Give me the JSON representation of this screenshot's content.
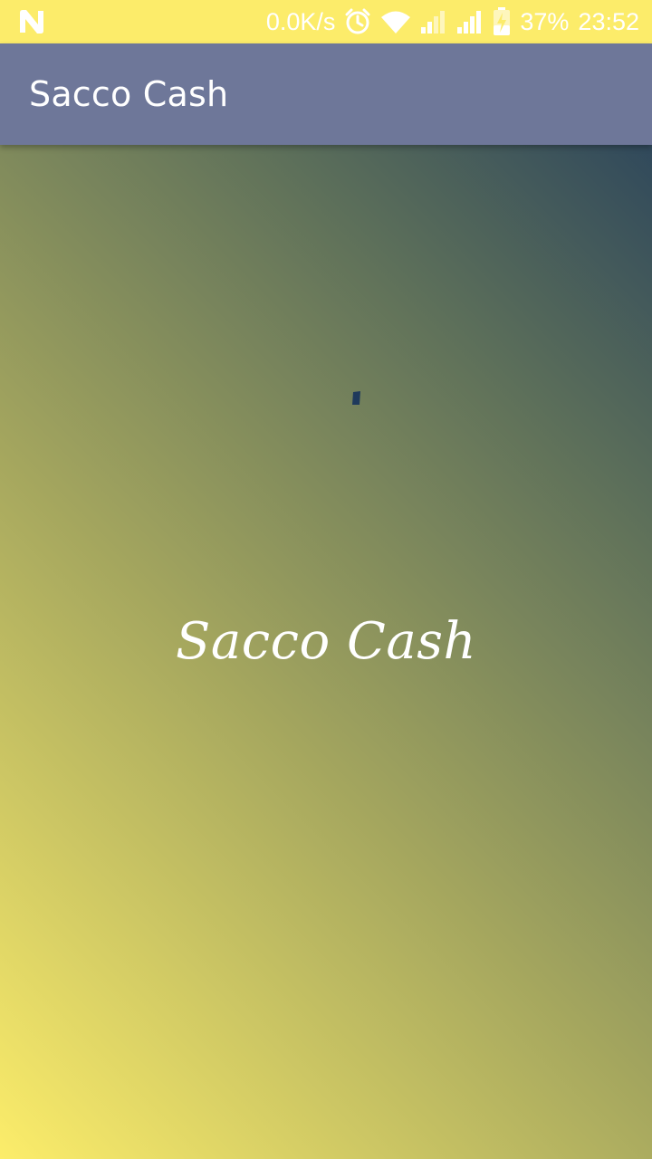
{
  "status_bar": {
    "network_speed": "0.0K/s",
    "battery_percent": "37%",
    "time": "23:52",
    "icons": [
      "n-logo-icon",
      "alarm-icon",
      "wifi-icon",
      "signal-icon",
      "signal-icon",
      "battery-charging-icon"
    ]
  },
  "app_bar": {
    "title": "Sacco Cash",
    "background_color": "#6e7799"
  },
  "splash": {
    "logo_text": "Sacco Cash",
    "text_color": "#ffffff",
    "gradient_colors": [
      "#1f3a5c",
      "#5b6e5a",
      "#a3a55e",
      "#fced6a"
    ]
  },
  "loading": {
    "indicator_color": "#1f3a5c"
  }
}
